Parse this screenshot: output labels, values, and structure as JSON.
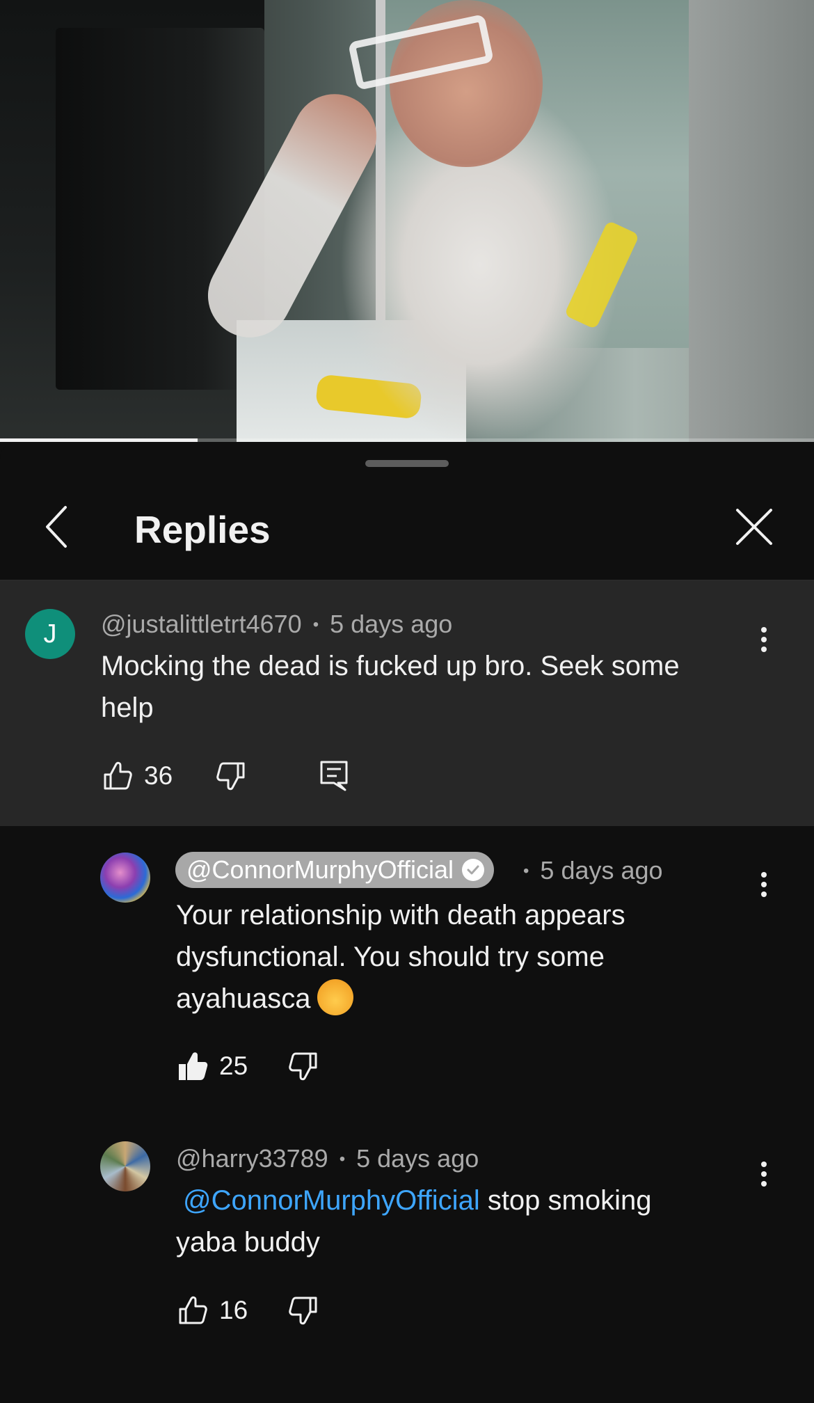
{
  "video": {
    "progress_fraction": 0.243
  },
  "sheet": {
    "title": "Replies",
    "back_icon": "chevron-left-icon",
    "close_icon": "close-icon"
  },
  "parent_comment": {
    "avatar_letter": "J",
    "avatar_color": "#0f8f7a",
    "author": "@justalittletrt4670",
    "separator": "•",
    "time": "5 days ago",
    "text_line1": "Mocking the dead is fucked up bro. Seek some",
    "text_line2": "help",
    "likes": "36"
  },
  "replies": [
    {
      "author": "@ConnorMurphyOfficial",
      "is_creator": true,
      "separator": "•",
      "time": "5 days ago",
      "text_line1": "Your relationship with death appears",
      "text_line2": "dysfunctional. You should try some",
      "text_line3": "ayahuasca",
      "emoji": "exploding-head-emoji",
      "likes": "25",
      "liked": true
    },
    {
      "author": "@harry33789",
      "separator": "•",
      "time": "5 days ago",
      "mention": "@ConnorMurphyOfficial",
      "text_line1_rest": " stop smoking",
      "text_line2": "yaba buddy",
      "likes": "16",
      "liked": false
    }
  ],
  "colors": {
    "background": "#0f0f0f",
    "parent_background": "#272727",
    "mention": "#3ea6ff",
    "meta_text": "#aaaaaa"
  }
}
